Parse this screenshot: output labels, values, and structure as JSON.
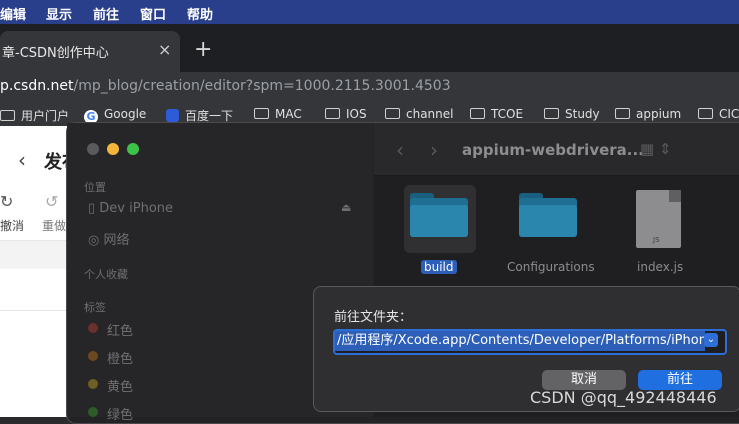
{
  "menubar": {
    "items": [
      "编辑",
      "显示",
      "前往",
      "窗口",
      "帮助"
    ],
    "bg": "#2a3f8c"
  },
  "browser": {
    "tab_title": "章-CSDN创作中心",
    "tab_close": "×",
    "new_tab": "+",
    "url_host": "p.csdn.net",
    "url_path": "/mp_blog/creation/editor?spm=1000.2115.3001.4503",
    "bookmarks": [
      "用户门户",
      "Google",
      "百度一下",
      "MAC",
      "IOS",
      "channel",
      "TCOE",
      "Study",
      "appium",
      "CIC"
    ]
  },
  "page": {
    "back": "‹",
    "title": "发布",
    "undo_label": "撤消",
    "redo_label": "重做"
  },
  "finder": {
    "path_title": "appium-webdrivera...",
    "sidebar": {
      "locations_header": "位置",
      "device": "Dev iPhone",
      "network": "网络",
      "favorites_header": "个人收藏",
      "tags_header": "标签",
      "tags": [
        {
          "label": "红色",
          "color": "#6b2f2d"
        },
        {
          "label": "橙色",
          "color": "#6b4a22"
        },
        {
          "label": "黄色",
          "color": "#6b5f24"
        },
        {
          "label": "绿色",
          "color": "#2f5a2a"
        }
      ]
    },
    "files": [
      "build",
      "Configurations",
      "index.js"
    ],
    "doc_badge": "JS"
  },
  "dialog": {
    "title": "前往文件夹：",
    "path_value": "/应用程序/Xcode.app/Contents/Developer/Platforms/iPhoneOS",
    "cancel": "取消",
    "go": "前往",
    "accent": "#1f6fe0"
  },
  "watermark": "CSDN @qq_492448446"
}
